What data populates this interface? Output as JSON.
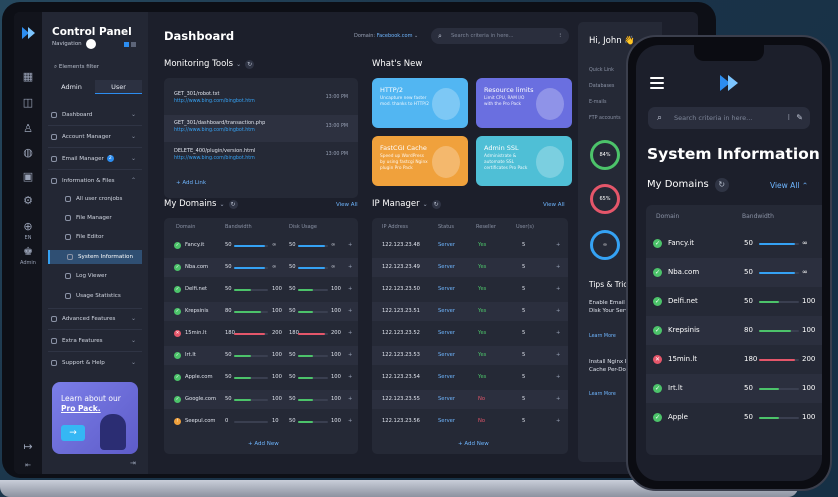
{
  "colors": {
    "accent": "#2c8df0",
    "link": "#6fb6ff",
    "ok": "#4cc36a",
    "err": "#e5566a",
    "warn": "#f0a13c",
    "cyan": "#35a2f4"
  },
  "sidebar": {
    "title": "Control Panel",
    "navigation_label": "Navigation",
    "filter": "Elements filter",
    "tabs": [
      "Admin",
      "User"
    ],
    "items": [
      {
        "label": "Dashboard"
      },
      {
        "label": "Account Manager"
      },
      {
        "label": "Email Manager",
        "badge": "2"
      },
      {
        "label": "Information & Files"
      },
      {
        "label": "All user cronjobs"
      },
      {
        "label": "File Manager"
      },
      {
        "label": "File Editor"
      },
      {
        "label": "System Information"
      },
      {
        "label": "Log Viewer"
      },
      {
        "label": "Usage Statistics"
      },
      {
        "label": "Advanced Features"
      },
      {
        "label": "Extra Features"
      },
      {
        "label": "Support & Help"
      }
    ],
    "promo_line1": "Learn about our",
    "promo_line2": "Pro Pack.",
    "rail": {
      "en": "EN",
      "admin": "Admin"
    }
  },
  "header": {
    "title": "Dashboard",
    "domain_label": "Domain:",
    "domain_value": "Facebook.com",
    "search_placeholder": "Search criteria in here..."
  },
  "monitoring": {
    "title": "Monitoring Tools",
    "add": "Add Link",
    "rows": [
      {
        "path": "GET_301/robot.txt",
        "url": "http://www.bing.com/bingbot.htm",
        "time": "13:00 PM"
      },
      {
        "path": "GET_301/dashboard/transaction.php",
        "url": "http://www.bing.com/bingbot.htm",
        "time": "13:00 PM"
      },
      {
        "path": "DELETE_400/plugin/version.html",
        "url": "http://www.bing.com/bingbot.htm",
        "time": "13:00 PM"
      }
    ]
  },
  "whatsnew": {
    "title": "What's New",
    "cards": [
      {
        "title": "HTTP/2",
        "desc": "Uncapture new faster mod. thanks to HTTP/2",
        "color": "#52b6f2"
      },
      {
        "title": "Resource limits",
        "desc": "Limit CPU, RAM I/O with the Pro Pack",
        "color": "#6a6fe0"
      },
      {
        "title": "FastCGI Cache",
        "desc": "Speed up WordPress by using fastcgi Nginx plugin Pro Pack",
        "color": "#f0a13c"
      },
      {
        "title": "Admin SSL",
        "desc": "Administrate & automate SSL certificates Pro Pack",
        "color": "#4fbfd6"
      }
    ]
  },
  "domains": {
    "title": "My Domains",
    "view_all": "View All",
    "add": "Add New",
    "headers": [
      "Domain",
      "Bandwidth",
      "Disk Usage"
    ],
    "rows": [
      {
        "name": "Fancy.it",
        "status": "ok",
        "bw": "50",
        "bw_max": "∞",
        "bw_frac": 0.9,
        "du": "50",
        "du_max": "∞",
        "du_frac": 0.9
      },
      {
        "name": "Nba.com",
        "status": "ok",
        "bw": "50",
        "bw_max": "∞",
        "bw_frac": 0.9,
        "du": "50",
        "du_max": "∞",
        "du_frac": 0.9
      },
      {
        "name": "Delfi.net",
        "status": "ok",
        "bw": "50",
        "bw_max": "100",
        "bw_frac": 0.5,
        "du": "50",
        "du_max": "100",
        "du_frac": 0.5
      },
      {
        "name": "Krepsinis",
        "status": "ok",
        "bw": "80",
        "bw_max": "100",
        "bw_frac": 0.8,
        "du": "50",
        "du_max": "100",
        "du_frac": 0.5
      },
      {
        "name": "15min.lt",
        "status": "err",
        "bw": "180",
        "bw_max": "200",
        "bw_frac": 0.9,
        "du": "180",
        "du_max": "200",
        "du_frac": 0.9
      },
      {
        "name": "Irt.lt",
        "status": "ok",
        "bw": "50",
        "bw_max": "100",
        "bw_frac": 0.5,
        "du": "50",
        "du_max": "100",
        "du_frac": 0.5
      },
      {
        "name": "Apple.com",
        "status": "ok",
        "bw": "50",
        "bw_max": "100",
        "bw_frac": 0.5,
        "du": "50",
        "du_max": "100",
        "du_frac": 0.5
      },
      {
        "name": "Google.com",
        "status": "ok",
        "bw": "50",
        "bw_max": "100",
        "bw_frac": 0.5,
        "du": "50",
        "du_max": "100",
        "du_frac": 0.5
      },
      {
        "name": "Seepul.com",
        "status": "warn",
        "bw": "0",
        "bw_max": "10",
        "bw_frac": 0.0,
        "du": "50",
        "du_max": "100",
        "du_frac": 0.5
      }
    ]
  },
  "ip": {
    "title": "IP Manager",
    "view_all": "View All",
    "add": "Add New",
    "headers": [
      "IP Address",
      "Status",
      "Reseller",
      "User(s)"
    ],
    "rows": [
      {
        "ip": "122.123.23.48",
        "status": "Server",
        "reseller": "Yes",
        "users": "5"
      },
      {
        "ip": "122.123.23.49",
        "status": "Server",
        "reseller": "Yes",
        "users": "5"
      },
      {
        "ip": "122.123.23.50",
        "status": "Server",
        "reseller": "Yes",
        "users": "5"
      },
      {
        "ip": "122.123.23.51",
        "status": "Server",
        "reseller": "Yes",
        "users": "5"
      },
      {
        "ip": "122.123.23.52",
        "status": "Server",
        "reseller": "Yes",
        "users": "5"
      },
      {
        "ip": "122.123.23.53",
        "status": "Server",
        "reseller": "Yes",
        "users": "5"
      },
      {
        "ip": "122.123.23.54",
        "status": "Server",
        "reseller": "Yes",
        "users": "5"
      },
      {
        "ip": "122.123.23.55",
        "status": "Server",
        "reseller": "No",
        "users": "5"
      },
      {
        "ip": "122.123.23.56",
        "status": "Server",
        "reseller": "No",
        "users": "5"
      }
    ]
  },
  "rightpanel": {
    "greeting": "Hi, John 👋",
    "links": [
      "Quick Link",
      "Databases",
      "E-mails",
      "FTP accounts"
    ],
    "rings": [
      "84%",
      "65%",
      "∞"
    ],
    "tips_title": "Tips & Tricks",
    "tips": [
      {
        "text": "Enable Email and Save Disk Your Server",
        "more": "Learn More"
      },
      {
        "text": "Install Nginx Proxy and Cache Per-Domain",
        "more": "Learn More"
      }
    ]
  },
  "phone": {
    "search_placeholder": "Search criteria in here...",
    "title": "System Information",
    "domains_title": "My Domains",
    "view_all": "View All",
    "headers": [
      "Domain",
      "Bandwidth"
    ],
    "rows": [
      {
        "name": "Fancy.it",
        "status": "ok",
        "bw": "50",
        "max": "∞",
        "frac": 0.9
      },
      {
        "name": "Nba.com",
        "status": "ok",
        "bw": "50",
        "max": "∞",
        "frac": 0.9
      },
      {
        "name": "Delfi.net",
        "status": "ok",
        "bw": "50",
        "max": "100",
        "frac": 0.5
      },
      {
        "name": "Krepsinis",
        "status": "ok",
        "bw": "80",
        "max": "100",
        "frac": 0.8
      },
      {
        "name": "15min.lt",
        "status": "err",
        "bw": "180",
        "max": "200",
        "frac": 0.9
      },
      {
        "name": "Irt.lt",
        "status": "ok",
        "bw": "50",
        "max": "100",
        "frac": 0.5
      },
      {
        "name": "Apple",
        "status": "ok",
        "bw": "50",
        "max": "100",
        "frac": 0.5
      }
    ]
  }
}
